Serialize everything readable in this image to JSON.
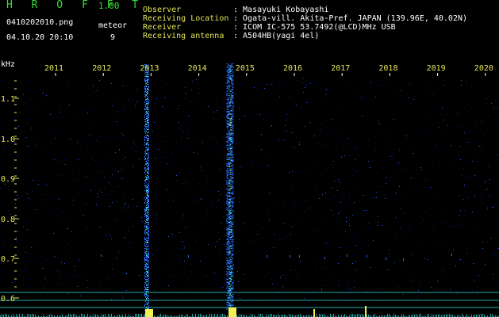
{
  "app": {
    "name": "H R O F F T",
    "version": "1.00"
  },
  "file": {
    "filename": "0410202010.png",
    "datetime": "04.10.20 20:10",
    "mode_label": "meteor",
    "meteor_count": "9"
  },
  "info": {
    "labels": [
      "Observer",
      "Receiving Location",
      "Receiver",
      "Receiving antenna"
    ],
    "values": [
      ": Masayuki Kobayashi",
      ": Ogata-vill. Akita-Pref. JAPAN (139.96E, 40.02N)",
      ": ICOM IC-575 53.7492(@LCD)MHz USB",
      ": A504HB(yagi 4el)"
    ]
  },
  "spectrogram": {
    "unit_label": "kHz",
    "time_ticks": [
      "2011",
      "2012",
      "2013",
      "2014",
      "2015",
      "2016",
      "2017",
      "2018",
      "2019",
      "2020"
    ],
    "freq_ticks": [
      "1.1",
      "1.0",
      "0.9",
      "0.8",
      "0.7",
      "0.6"
    ],
    "colors": {
      "background": "#000000",
      "noise_dark": "#0b1f7a",
      "noise_bright": "#2a66ff",
      "meteor_cyan": "#33e6e6",
      "meteor_yellow": "#f0f050",
      "label_yellow": "#e6e65a",
      "axis_white": "#ffffff",
      "title_green": "#33dd33",
      "baseline_cyan": "#22aaaa"
    }
  }
}
